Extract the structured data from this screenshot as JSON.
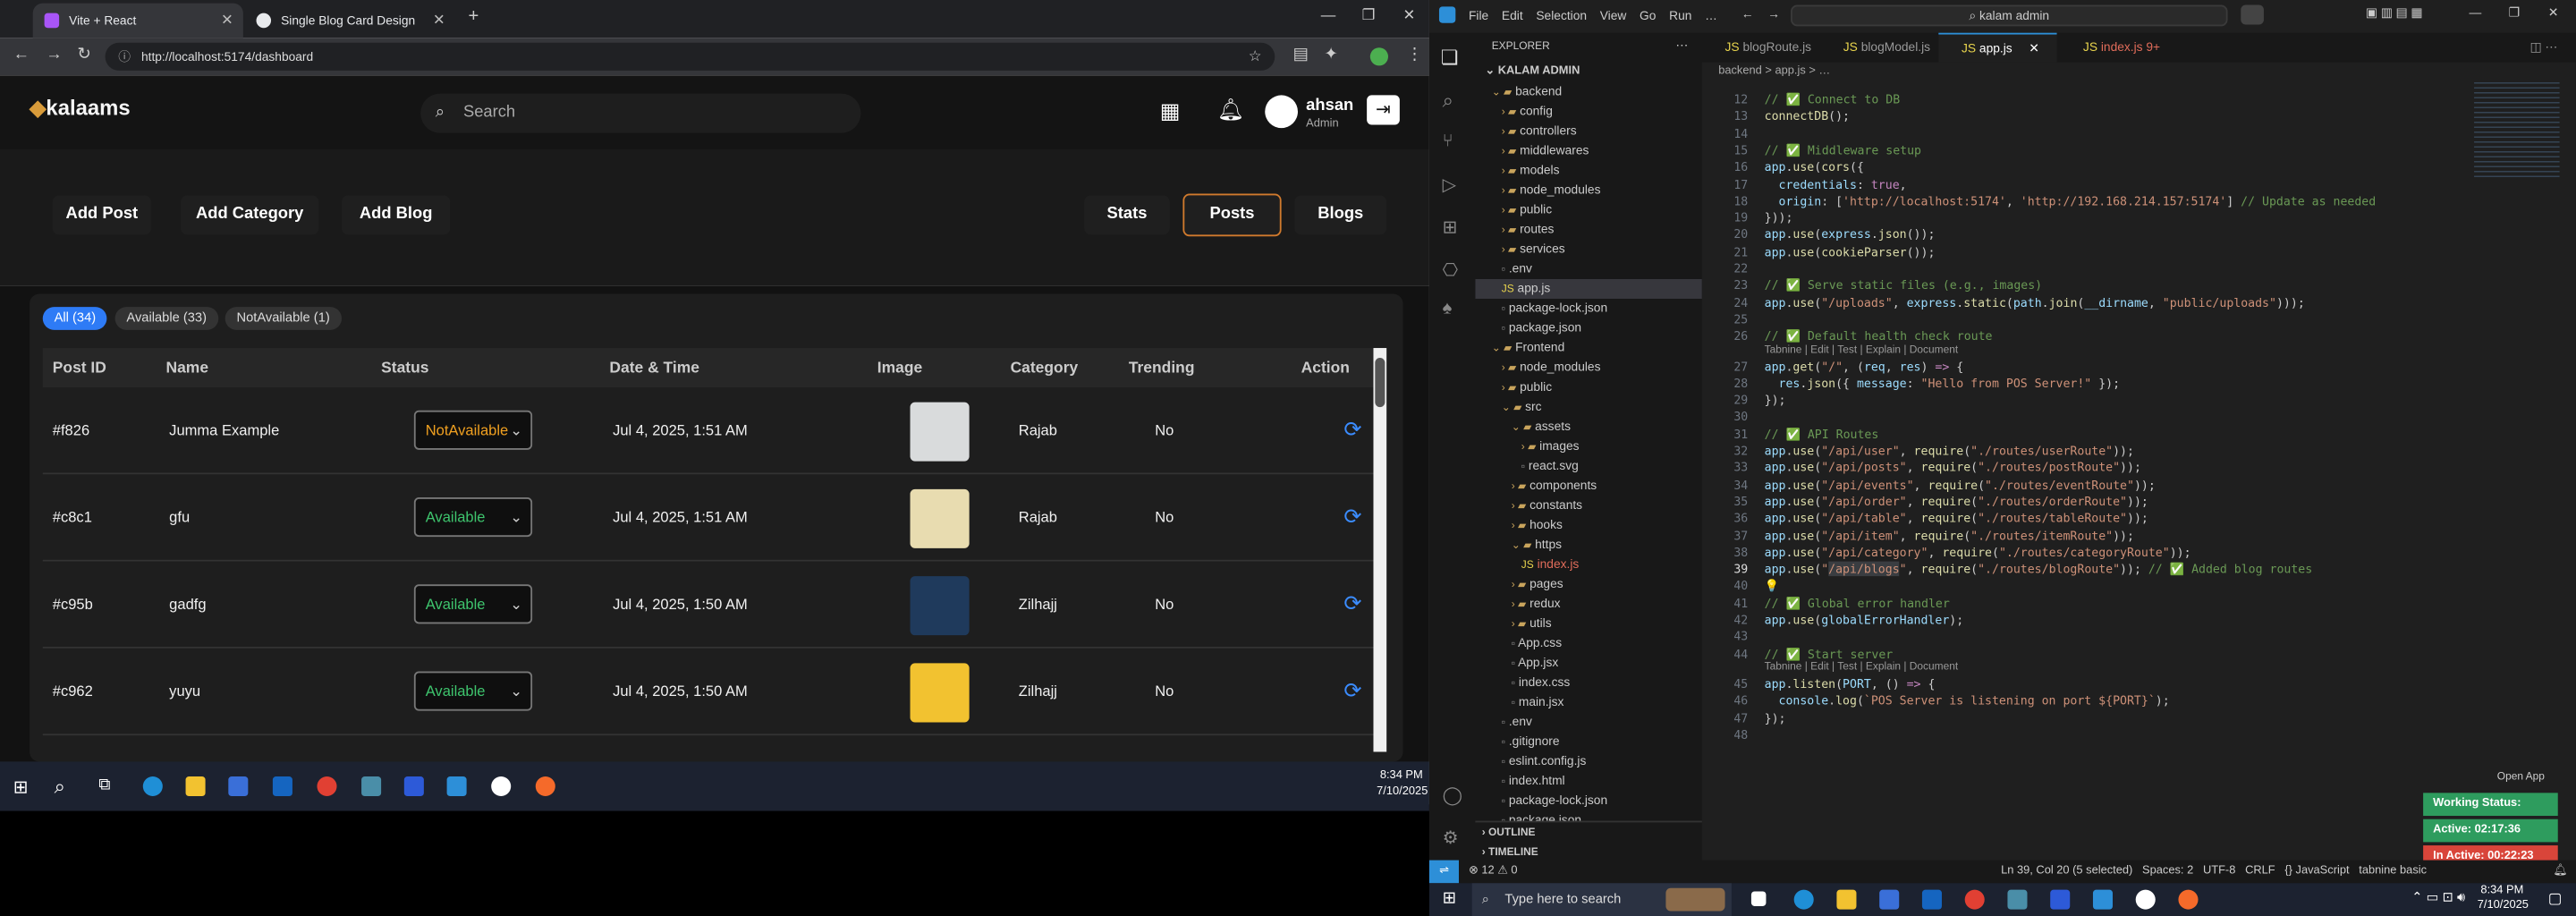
{
  "browser": {
    "tab1": "Vite + React",
    "tab2": "Single Blog Card Design",
    "url": "http://localhost:5174/dashboard"
  },
  "app": {
    "logo": "kalaams",
    "search_placeholder": "Search",
    "user_name": "ahsan",
    "user_role": "Admin",
    "buttons_left": [
      "Add Post",
      "Add Category",
      "Add Blog"
    ],
    "buttons_right": [
      "Stats",
      "Posts",
      "Blogs"
    ],
    "filters": [
      "All (34)",
      "Available (33)",
      "NotAvailable (1)"
    ],
    "columns": [
      "Post ID",
      "Name",
      "Status",
      "Date & Time",
      "Image",
      "Category",
      "Trending",
      "Action"
    ],
    "rows": [
      {
        "id": "#f826",
        "name": "Jumma Example",
        "status": "NotAvailable",
        "date": "Jul 4, 2025, 1:51 AM",
        "category": "Rajab",
        "trending": "No",
        "img_color": "#d9dbdc"
      },
      {
        "id": "#c8c1",
        "name": "gfu",
        "status": "Available",
        "date": "Jul 4, 2025, 1:51 AM",
        "category": "Rajab",
        "trending": "No",
        "img_color": "#e8dcb0"
      },
      {
        "id": "#c95b",
        "name": "gadfg",
        "status": "Available",
        "date": "Jul 4, 2025, 1:50 AM",
        "category": "Zilhajj",
        "trending": "No",
        "img_color": "#1f3a5c"
      },
      {
        "id": "#c962",
        "name": "yuyu",
        "status": "Available",
        "date": "Jul 4, 2025, 1:50 AM",
        "category": "Zilhajj",
        "trending": "No",
        "img_color": "#f2c230"
      }
    ]
  },
  "taskbar_left": {
    "time": "8:34 PM",
    "date": "7/10/2025"
  },
  "vscode": {
    "title": "kalam admin",
    "menu": [
      "File",
      "Edit",
      "Selection",
      "View",
      "Go",
      "Run",
      "…"
    ],
    "explorer_title": "EXPLORER",
    "workspace": "KALAM ADMIN",
    "tree": [
      {
        "d": 1,
        "t": "backend",
        "type": "open"
      },
      {
        "d": 2,
        "t": "config",
        "type": "folder"
      },
      {
        "d": 2,
        "t": "controllers",
        "type": "folder"
      },
      {
        "d": 2,
        "t": "middlewares",
        "type": "folder"
      },
      {
        "d": 2,
        "t": "models",
        "type": "folder"
      },
      {
        "d": 2,
        "t": "node_modules",
        "type": "folder"
      },
      {
        "d": 2,
        "t": "public",
        "type": "folder"
      },
      {
        "d": 2,
        "t": "routes",
        "type": "folder"
      },
      {
        "d": 2,
        "t": "services",
        "type": "folder"
      },
      {
        "d": 2,
        "t": ".env",
        "type": "file"
      },
      {
        "d": 2,
        "t": "app.js",
        "type": "js"
      },
      {
        "d": 2,
        "t": "package-lock.json",
        "type": "file"
      },
      {
        "d": 2,
        "t": "package.json",
        "type": "file"
      },
      {
        "d": 1,
        "t": "Frontend",
        "type": "open"
      },
      {
        "d": 2,
        "t": "node_modules",
        "type": "folder"
      },
      {
        "d": 2,
        "t": "public",
        "type": "folder"
      },
      {
        "d": 2,
        "t": "src",
        "type": "open"
      },
      {
        "d": 3,
        "t": "assets",
        "type": "open"
      },
      {
        "d": 4,
        "t": "images",
        "type": "folder"
      },
      {
        "d": 4,
        "t": "react.svg",
        "type": "file"
      },
      {
        "d": 3,
        "t": "components",
        "type": "folder"
      },
      {
        "d": 3,
        "t": "constants",
        "type": "folder"
      },
      {
        "d": 3,
        "t": "hooks",
        "type": "folder"
      },
      {
        "d": 3,
        "t": "https",
        "type": "open"
      },
      {
        "d": 4,
        "t": "index.js",
        "type": "js"
      },
      {
        "d": 3,
        "t": "pages",
        "type": "folder"
      },
      {
        "d": 3,
        "t": "redux",
        "type": "folder"
      },
      {
        "d": 3,
        "t": "utils",
        "type": "folder"
      },
      {
        "d": 3,
        "t": "App.css",
        "type": "file"
      },
      {
        "d": 3,
        "t": "App.jsx",
        "type": "file"
      },
      {
        "d": 3,
        "t": "index.css",
        "type": "file"
      },
      {
        "d": 3,
        "t": "main.jsx",
        "type": "file"
      },
      {
        "d": 2,
        "t": ".env",
        "type": "file"
      },
      {
        "d": 2,
        "t": ".gitignore",
        "type": "file"
      },
      {
        "d": 2,
        "t": "eslint.config.js",
        "type": "file"
      },
      {
        "d": 2,
        "t": "index.html",
        "type": "file"
      },
      {
        "d": 2,
        "t": "package-lock.json",
        "type": "file"
      },
      {
        "d": 2,
        "t": "package.json",
        "type": "file"
      }
    ],
    "outline": "OUTLINE",
    "timeline": "TIMELINE",
    "editor_tabs": [
      "blogRoute.js",
      "blogModel.js",
      "app.js",
      "index.js 9+"
    ],
    "breadcrumb": "backend > app.js > …",
    "code": [
      {
        "n": "12",
        "h": "<span class='cm'>// ✅ Connect to DB</span>"
      },
      {
        "n": "13",
        "h": "<span class='fn'>connectDB</span>();"
      },
      {
        "n": "14",
        "h": ""
      },
      {
        "n": "15",
        "h": "<span class='cm'>// ✅ Middleware setup</span>"
      },
      {
        "n": "16",
        "h": "<span class='vr'>app</span>.<span class='fn'>use</span>(<span class='fn'>cors</span>({"
      },
      {
        "n": "17",
        "h": "  <span class='vr'>credentials</span>: <span class='kw'>true</span>,"
      },
      {
        "n": "18",
        "h": "  <span class='vr'>origin</span>: [<span class='st'>'http://localhost:5174'</span>, <span class='st'>'http://192.168.214.157:5174'</span>] <span class='cm'>// Update as needed</span>"
      },
      {
        "n": "19",
        "h": "}));"
      },
      {
        "n": "20",
        "h": "<span class='vr'>app</span>.<span class='fn'>use</span>(<span class='vr'>express</span>.<span class='fn'>json</span>());"
      },
      {
        "n": "21",
        "h": "<span class='vr'>app</span>.<span class='fn'>use</span>(<span class='fn'>cookieParser</span>());"
      },
      {
        "n": "22",
        "h": ""
      },
      {
        "n": "23",
        "h": "<span class='cm'>// ✅ Serve static files (e.g., images)</span>"
      },
      {
        "n": "24",
        "h": "<span class='vr'>app</span>.<span class='fn'>use</span>(<span class='st'>\"/uploads\"</span>, <span class='vr'>express</span>.<span class='fn'>static</span>(<span class='vr'>path</span>.<span class='fn'>join</span>(<span class='vr'>__dirname</span>, <span class='st'>\"public/uploads\"</span>)));"
      },
      {
        "n": "25",
        "h": ""
      },
      {
        "n": "26",
        "h": "<span class='cm'>// ✅ Default health check route</span>"
      },
      {
        "n": "27",
        "h": "<span class='vr'>app</span>.<span class='fn'>get</span>(<span class='st'>\"/\"</span>, (<span class='vr'>req</span>, <span class='vr'>res</span>) <span class='kw'>=></span> {",
        "lens": "Tabnine | Edit | Test | Explain | Document"
      },
      {
        "n": "28",
        "h": "  <span class='vr'>res</span>.<span class='fn'>json</span>({ <span class='vr'>message</span>: <span class='st'>\"Hello from POS Server!\"</span> });"
      },
      {
        "n": "29",
        "h": "});"
      },
      {
        "n": "30",
        "h": ""
      },
      {
        "n": "31",
        "h": "<span class='cm'>// ✅ API Routes</span>"
      },
      {
        "n": "32",
        "h": "<span class='vr'>app</span>.<span class='fn'>use</span>(<span class='st'>\"/api/user\"</span>, <span class='fn'>require</span>(<span class='st'>\"./routes/userRoute\"</span>));"
      },
      {
        "n": "33",
        "h": "<span class='vr'>app</span>.<span class='fn'>use</span>(<span class='st'>\"/api/posts\"</span>, <span class='fn'>require</span>(<span class='st'>\"./routes/postRoute\"</span>));"
      },
      {
        "n": "34",
        "h": "<span class='vr'>app</span>.<span class='fn'>use</span>(<span class='st'>\"/api/events\"</span>, <span class='fn'>require</span>(<span class='st'>\"./routes/eventRoute\"</span>));"
      },
      {
        "n": "35",
        "h": "<span class='vr'>app</span>.<span class='fn'>use</span>(<span class='st'>\"/api/order\"</span>, <span class='fn'>require</span>(<span class='st'>\"./routes/orderRoute\"</span>));"
      },
      {
        "n": "36",
        "h": "<span class='vr'>app</span>.<span class='fn'>use</span>(<span class='st'>\"/api/table\"</span>, <span class='fn'>require</span>(<span class='st'>\"./routes/tableRoute\"</span>));"
      },
      {
        "n": "37",
        "h": "<span class='vr'>app</span>.<span class='fn'>use</span>(<span class='st'>\"/api/item\"</span>, <span class='fn'>require</span>(<span class='st'>\"./routes/itemRoute\"</span>));"
      },
      {
        "n": "38",
        "h": "<span class='vr'>app</span>.<span class='fn'>use</span>(<span class='st'>\"/api/category\"</span>, <span class='fn'>require</span>(<span class='st'>\"./routes/categoryRoute\"</span>));"
      },
      {
        "n": "39",
        "h": "<span class='vr'>app</span>.<span class='fn'>use</span>(<span class='st'>\"<span style='background:#3a3d41'>/api/blogs</span>\"</span>, <span class='fn'>require</span>(<span class='st'>\"./routes/blogRoute\"</span>)); <span class='cm'>// ✅ Added blog routes</span>"
      },
      {
        "n": "40",
        "h": "💡"
      },
      {
        "n": "41",
        "h": "<span class='cm'>// ✅ Global error handler</span>"
      },
      {
        "n": "42",
        "h": "<span class='vr'>app</span>.<span class='fn'>use</span>(<span class='vr'>globalErrorHandler</span>);"
      },
      {
        "n": "43",
        "h": ""
      },
      {
        "n": "44",
        "h": "<span class='cm'>// ✅ Start server</span>"
      },
      {
        "n": "45",
        "h": "<span class='vr'>app</span>.<span class='fn'>listen</span>(<span class='vr'>PORT</span>, () <span class='kw'>=></span> {",
        "lens": "Tabnine | Edit | Test | Explain | Document"
      },
      {
        "n": "46",
        "h": "  <span class='vr'>console</span>.<span class='fn'>log</span>(<span class='st'>`POS Server is listening on port ${PORT}`</span>);"
      },
      {
        "n": "47",
        "h": "});"
      },
      {
        "n": "48",
        "h": ""
      }
    ],
    "open_app": "Open App",
    "working_status": "Working Status: Active",
    "active": "Active: 02:17:36",
    "inactive": "In Active: 00:22:23",
    "status_left": "⊗ 12 ⚠ 0",
    "status_right": "Ln 39, Col 20 (5 selected)   Spaces: 2   UTF-8   CRLF   {} JavaScript   tabnine basic"
  },
  "taskbar_right": {
    "search_placeholder": "Type here to search",
    "time": "8:34 PM",
    "date": "7/10/2025"
  }
}
